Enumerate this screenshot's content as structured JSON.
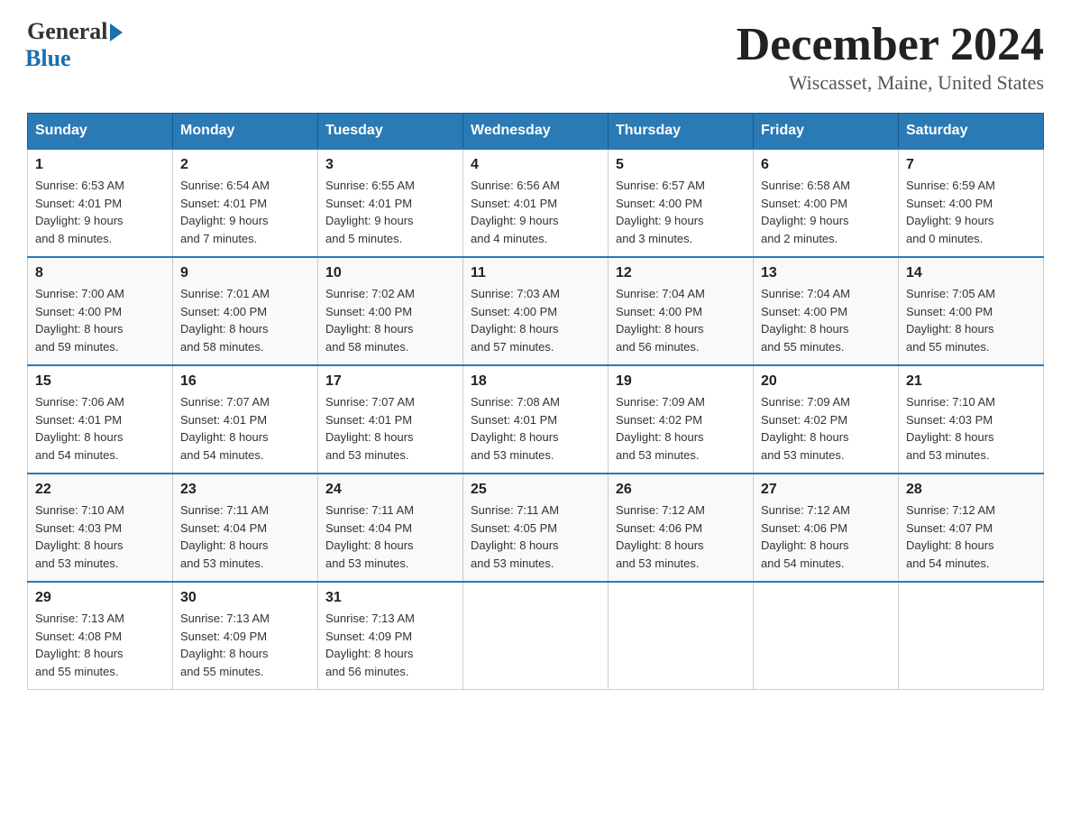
{
  "header": {
    "logo_general": "General",
    "logo_blue": "Blue",
    "month_title": "December 2024",
    "location": "Wiscasset, Maine, United States"
  },
  "days_of_week": [
    "Sunday",
    "Monday",
    "Tuesday",
    "Wednesday",
    "Thursday",
    "Friday",
    "Saturday"
  ],
  "weeks": [
    [
      {
        "day": "1",
        "sunrise": "6:53 AM",
        "sunset": "4:01 PM",
        "daylight": "9 hours and 8 minutes."
      },
      {
        "day": "2",
        "sunrise": "6:54 AM",
        "sunset": "4:01 PM",
        "daylight": "9 hours and 7 minutes."
      },
      {
        "day": "3",
        "sunrise": "6:55 AM",
        "sunset": "4:01 PM",
        "daylight": "9 hours and 5 minutes."
      },
      {
        "day": "4",
        "sunrise": "6:56 AM",
        "sunset": "4:01 PM",
        "daylight": "9 hours and 4 minutes."
      },
      {
        "day": "5",
        "sunrise": "6:57 AM",
        "sunset": "4:00 PM",
        "daylight": "9 hours and 3 minutes."
      },
      {
        "day": "6",
        "sunrise": "6:58 AM",
        "sunset": "4:00 PM",
        "daylight": "9 hours and 2 minutes."
      },
      {
        "day": "7",
        "sunrise": "6:59 AM",
        "sunset": "4:00 PM",
        "daylight": "9 hours and 0 minutes."
      }
    ],
    [
      {
        "day": "8",
        "sunrise": "7:00 AM",
        "sunset": "4:00 PM",
        "daylight": "8 hours and 59 minutes."
      },
      {
        "day": "9",
        "sunrise": "7:01 AM",
        "sunset": "4:00 PM",
        "daylight": "8 hours and 58 minutes."
      },
      {
        "day": "10",
        "sunrise": "7:02 AM",
        "sunset": "4:00 PM",
        "daylight": "8 hours and 58 minutes."
      },
      {
        "day": "11",
        "sunrise": "7:03 AM",
        "sunset": "4:00 PM",
        "daylight": "8 hours and 57 minutes."
      },
      {
        "day": "12",
        "sunrise": "7:04 AM",
        "sunset": "4:00 PM",
        "daylight": "8 hours and 56 minutes."
      },
      {
        "day": "13",
        "sunrise": "7:04 AM",
        "sunset": "4:00 PM",
        "daylight": "8 hours and 55 minutes."
      },
      {
        "day": "14",
        "sunrise": "7:05 AM",
        "sunset": "4:00 PM",
        "daylight": "8 hours and 55 minutes."
      }
    ],
    [
      {
        "day": "15",
        "sunrise": "7:06 AM",
        "sunset": "4:01 PM",
        "daylight": "8 hours and 54 minutes."
      },
      {
        "day": "16",
        "sunrise": "7:07 AM",
        "sunset": "4:01 PM",
        "daylight": "8 hours and 54 minutes."
      },
      {
        "day": "17",
        "sunrise": "7:07 AM",
        "sunset": "4:01 PM",
        "daylight": "8 hours and 53 minutes."
      },
      {
        "day": "18",
        "sunrise": "7:08 AM",
        "sunset": "4:01 PM",
        "daylight": "8 hours and 53 minutes."
      },
      {
        "day": "19",
        "sunrise": "7:09 AM",
        "sunset": "4:02 PM",
        "daylight": "8 hours and 53 minutes."
      },
      {
        "day": "20",
        "sunrise": "7:09 AM",
        "sunset": "4:02 PM",
        "daylight": "8 hours and 53 minutes."
      },
      {
        "day": "21",
        "sunrise": "7:10 AM",
        "sunset": "4:03 PM",
        "daylight": "8 hours and 53 minutes."
      }
    ],
    [
      {
        "day": "22",
        "sunrise": "7:10 AM",
        "sunset": "4:03 PM",
        "daylight": "8 hours and 53 minutes."
      },
      {
        "day": "23",
        "sunrise": "7:11 AM",
        "sunset": "4:04 PM",
        "daylight": "8 hours and 53 minutes."
      },
      {
        "day": "24",
        "sunrise": "7:11 AM",
        "sunset": "4:04 PM",
        "daylight": "8 hours and 53 minutes."
      },
      {
        "day": "25",
        "sunrise": "7:11 AM",
        "sunset": "4:05 PM",
        "daylight": "8 hours and 53 minutes."
      },
      {
        "day": "26",
        "sunrise": "7:12 AM",
        "sunset": "4:06 PM",
        "daylight": "8 hours and 53 minutes."
      },
      {
        "day": "27",
        "sunrise": "7:12 AM",
        "sunset": "4:06 PM",
        "daylight": "8 hours and 54 minutes."
      },
      {
        "day": "28",
        "sunrise": "7:12 AM",
        "sunset": "4:07 PM",
        "daylight": "8 hours and 54 minutes."
      }
    ],
    [
      {
        "day": "29",
        "sunrise": "7:13 AM",
        "sunset": "4:08 PM",
        "daylight": "8 hours and 55 minutes."
      },
      {
        "day": "30",
        "sunrise": "7:13 AM",
        "sunset": "4:09 PM",
        "daylight": "8 hours and 55 minutes."
      },
      {
        "day": "31",
        "sunrise": "7:13 AM",
        "sunset": "4:09 PM",
        "daylight": "8 hours and 56 minutes."
      },
      null,
      null,
      null,
      null
    ]
  ],
  "labels": {
    "sunrise": "Sunrise:",
    "sunset": "Sunset:",
    "daylight": "Daylight:"
  }
}
